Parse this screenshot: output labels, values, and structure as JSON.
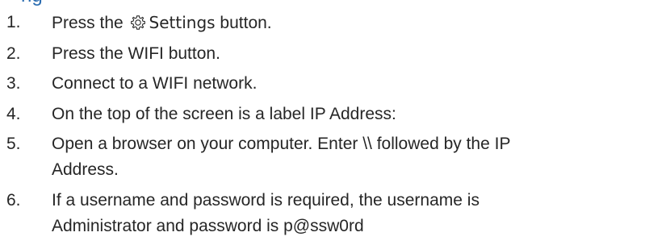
{
  "heading": "ng",
  "steps": [
    {
      "number": "1.",
      "before": "Press the ",
      "icon": "gear-icon",
      "settings": "Settings",
      "after": " button."
    },
    {
      "number": "2.",
      "text": "Press the WIFI button."
    },
    {
      "number": "3.",
      "text": "Connect to a WIFI network."
    },
    {
      "number": "4.",
      "text": "On the top of the screen is a label IP Address:"
    },
    {
      "number": "5.",
      "line1": "Open a browser on your computer. Enter \\\\ followed by the IP",
      "line2": "Address."
    },
    {
      "number": "6.",
      "line1": "If a username and password is required, the username is",
      "line2": "Administrator and password is p@ssw0rd"
    }
  ]
}
